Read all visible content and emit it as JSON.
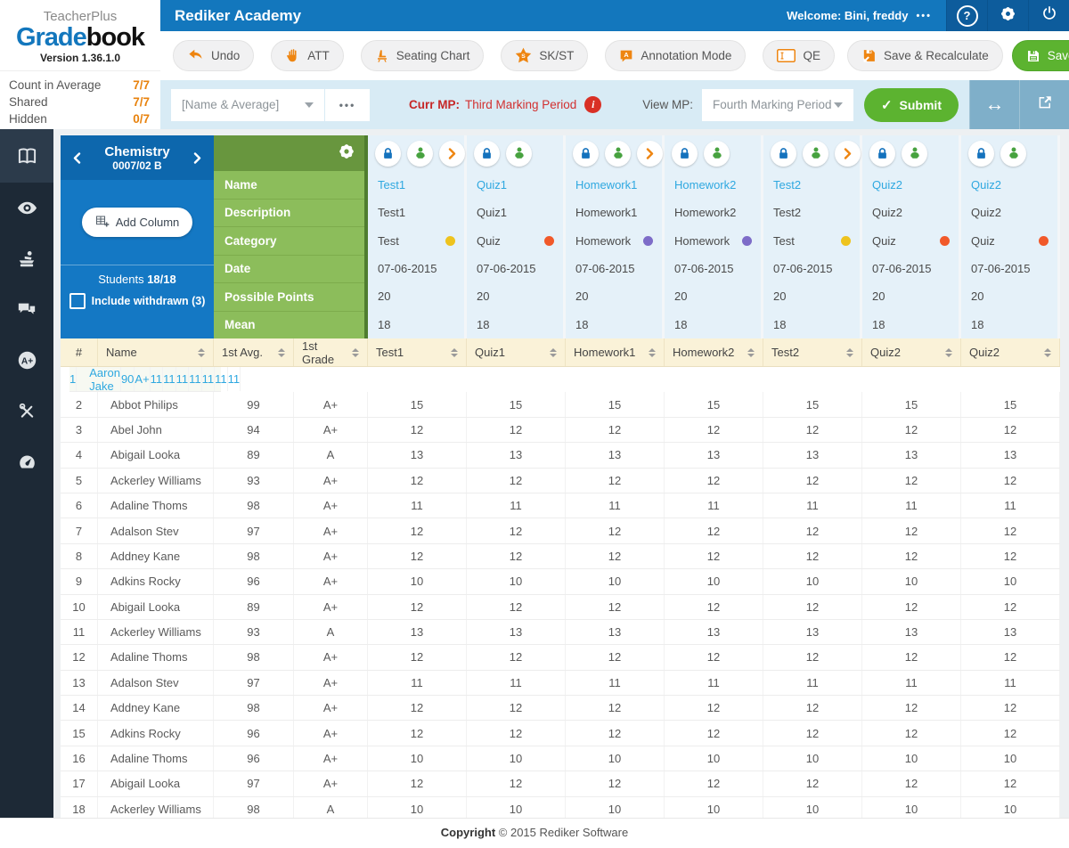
{
  "colors": {
    "brand_blue": "#1377bd",
    "accent_orange": "#ee8511",
    "action_green": "#5cb330",
    "alert_red": "#d93025",
    "link_blue": "#2fa8e0",
    "category_test_dot": "#eec31e",
    "category_quiz_dot": "#f1592a",
    "category_homework_dot": "#7d6cc8"
  },
  "logo": {
    "brand_top": "TeacherPlus",
    "brand_main_blue": "Grade",
    "brand_main_dark": "book",
    "version": "Version 1.36.1.0"
  },
  "summary_stats": [
    {
      "label": "Count in Average",
      "value": "7/7"
    },
    {
      "label": "Shared",
      "value": "7/7"
    },
    {
      "label": "Hidden",
      "value": "0/7"
    }
  ],
  "topbar": {
    "school_name": "Rediker Academy",
    "welcome_text": "Welcome: Bini, freddy",
    "welcome_dots": "•••",
    "icons": [
      "help",
      "gear",
      "power"
    ]
  },
  "toolbar": {
    "buttons": [
      {
        "icon": "undo",
        "label": "Undo"
      },
      {
        "icon": "hand",
        "label": "ATT"
      },
      {
        "icon": "chair",
        "label": "Seating Chart"
      },
      {
        "icon": "star-s",
        "label": "SK/ST"
      },
      {
        "icon": "annotation",
        "label": "Annotation Mode"
      },
      {
        "icon": "qe-box",
        "label": "QE"
      }
    ],
    "save_recalculate_label": "Save & Recalculate",
    "save_label": "Save"
  },
  "filterbar": {
    "view_dropdown_value": "[Name & Average]",
    "more_dots": "•••",
    "curr_mp_label": "Curr MP:",
    "curr_mp_value": "Third Marking Period",
    "view_mp_label": "View MP:",
    "view_mp_value": "Fourth Marking Period",
    "submit_label": "Submit",
    "right_icons": [
      "swap-arrows",
      "external-link"
    ]
  },
  "sidebar": {
    "items": [
      {
        "icon": "book-open",
        "active": true
      },
      {
        "icon": "eye",
        "active": false
      },
      {
        "icon": "podium",
        "active": false
      },
      {
        "icon": "chat-bubbles",
        "active": false
      },
      {
        "icon": "a-plus",
        "active": false
      },
      {
        "icon": "tools",
        "active": false
      },
      {
        "icon": "gauge",
        "active": false
      }
    ]
  },
  "class_panel": {
    "class_name": "Chemistry",
    "class_section": "0007/02 B",
    "add_column_label": "Add Column",
    "students_label": "Students",
    "students_count": "18/18",
    "withdrawn_label": "Include withdrawn (3)"
  },
  "field_labels": [
    "Name",
    "Description",
    "Category",
    "Date",
    "Possible Points",
    "Mean"
  ],
  "assignments": [
    {
      "name": "Test1",
      "description": "Test1",
      "category": "Test",
      "dot_color": "#eec31e",
      "date": "07-06-2015",
      "possible_points": "20",
      "mean": "18",
      "expandable": true
    },
    {
      "name": "Quiz1",
      "description": "Quiz1",
      "category": "Quiz",
      "dot_color": "#f1592a",
      "date": "07-06-2015",
      "possible_points": "20",
      "mean": "18",
      "expandable": false
    },
    {
      "name": "Homework1",
      "description": "Homework1",
      "category": "Homework",
      "dot_color": "#7d6cc8",
      "date": "07-06-2015",
      "possible_points": "20",
      "mean": "18",
      "expandable": true
    },
    {
      "name": "Homework2",
      "description": "Homework2",
      "category": "Homework",
      "dot_color": "#7d6cc8",
      "date": "07-06-2015",
      "possible_points": "20",
      "mean": "18",
      "expandable": false
    },
    {
      "name": "Test2",
      "description": "Test2",
      "category": "Test",
      "dot_color": "#eec31e",
      "date": "07-06-2015",
      "possible_points": "20",
      "mean": "18",
      "expandable": true
    },
    {
      "name": "Quiz2",
      "description": "Quiz2",
      "category": "Quiz",
      "dot_color": "#f1592a",
      "date": "07-06-2015",
      "possible_points": "20",
      "mean": "18",
      "expandable": false
    },
    {
      "name": "Quiz2",
      "description": "Quiz2",
      "category": "Quiz",
      "dot_color": "#f1592a",
      "date": "07-06-2015",
      "possible_points": "20",
      "mean": "18",
      "expandable": false
    }
  ],
  "grade_table": {
    "headers": [
      "#",
      "Name",
      "1st Avg.",
      "1st Grade",
      "Test1",
      "Quiz1",
      "Homework1",
      "Homework2",
      "Test2",
      "Quiz2",
      "Quiz2"
    ],
    "rows": [
      {
        "num": "1",
        "name": "Aaron Jake",
        "avg": "90",
        "grade": "A+",
        "score": "11",
        "selected": true
      },
      {
        "num": "2",
        "name": "Abbot Philips",
        "avg": "99",
        "grade": "A+",
        "score": "15",
        "selected": false
      },
      {
        "num": "3",
        "name": "Abel John",
        "avg": "94",
        "grade": "A+",
        "score": "12",
        "selected": false
      },
      {
        "num": "4",
        "name": "Abigail Looka",
        "avg": "89",
        "grade": "A",
        "score": "13",
        "selected": false
      },
      {
        "num": "5",
        "name": "Ackerley Williams",
        "avg": "93",
        "grade": "A+",
        "score": "12",
        "selected": false
      },
      {
        "num": "6",
        "name": "Adaline Thoms",
        "avg": "98",
        "grade": "A+",
        "score": "11",
        "selected": false
      },
      {
        "num": "7",
        "name": "Adalson Stev",
        "avg": "97",
        "grade": "A+",
        "score": "12",
        "selected": false
      },
      {
        "num": "8",
        "name": "Addney Kane",
        "avg": "98",
        "grade": "A+",
        "score": "12",
        "selected": false
      },
      {
        "num": "9",
        "name": "Adkins Rocky",
        "avg": "96",
        "grade": "A+",
        "score": "10",
        "selected": false
      },
      {
        "num": "10",
        "name": "Abigail Looka",
        "avg": "89",
        "grade": "A+",
        "score": "12",
        "selected": false
      },
      {
        "num": "11",
        "name": "Ackerley Williams",
        "avg": "93",
        "grade": "A",
        "score": "13",
        "selected": false
      },
      {
        "num": "12",
        "name": "Adaline Thoms",
        "avg": "98",
        "grade": "A+",
        "score": "12",
        "selected": false
      },
      {
        "num": "13",
        "name": "Adalson Stev",
        "avg": "97",
        "grade": "A+",
        "score": "11",
        "selected": false
      },
      {
        "num": "14",
        "name": "Addney Kane",
        "avg": "98",
        "grade": "A+",
        "score": "12",
        "selected": false
      },
      {
        "num": "15",
        "name": "Adkins Rocky",
        "avg": "96",
        "grade": "A+",
        "score": "12",
        "selected": false
      },
      {
        "num": "16",
        "name": "Adaline Thoms",
        "avg": "96",
        "grade": "A+",
        "score": "10",
        "selected": false
      },
      {
        "num": "17",
        "name": "Abigail Looka",
        "avg": "97",
        "grade": "A+",
        "score": "12",
        "selected": false
      },
      {
        "num": "18",
        "name": "Ackerley Williams",
        "avg": "98",
        "grade": "A",
        "score": "10",
        "selected": false
      }
    ]
  },
  "footer": {
    "copyright_bold": "Copyright",
    "copyright_rest": " © 2015 Rediker Software"
  }
}
